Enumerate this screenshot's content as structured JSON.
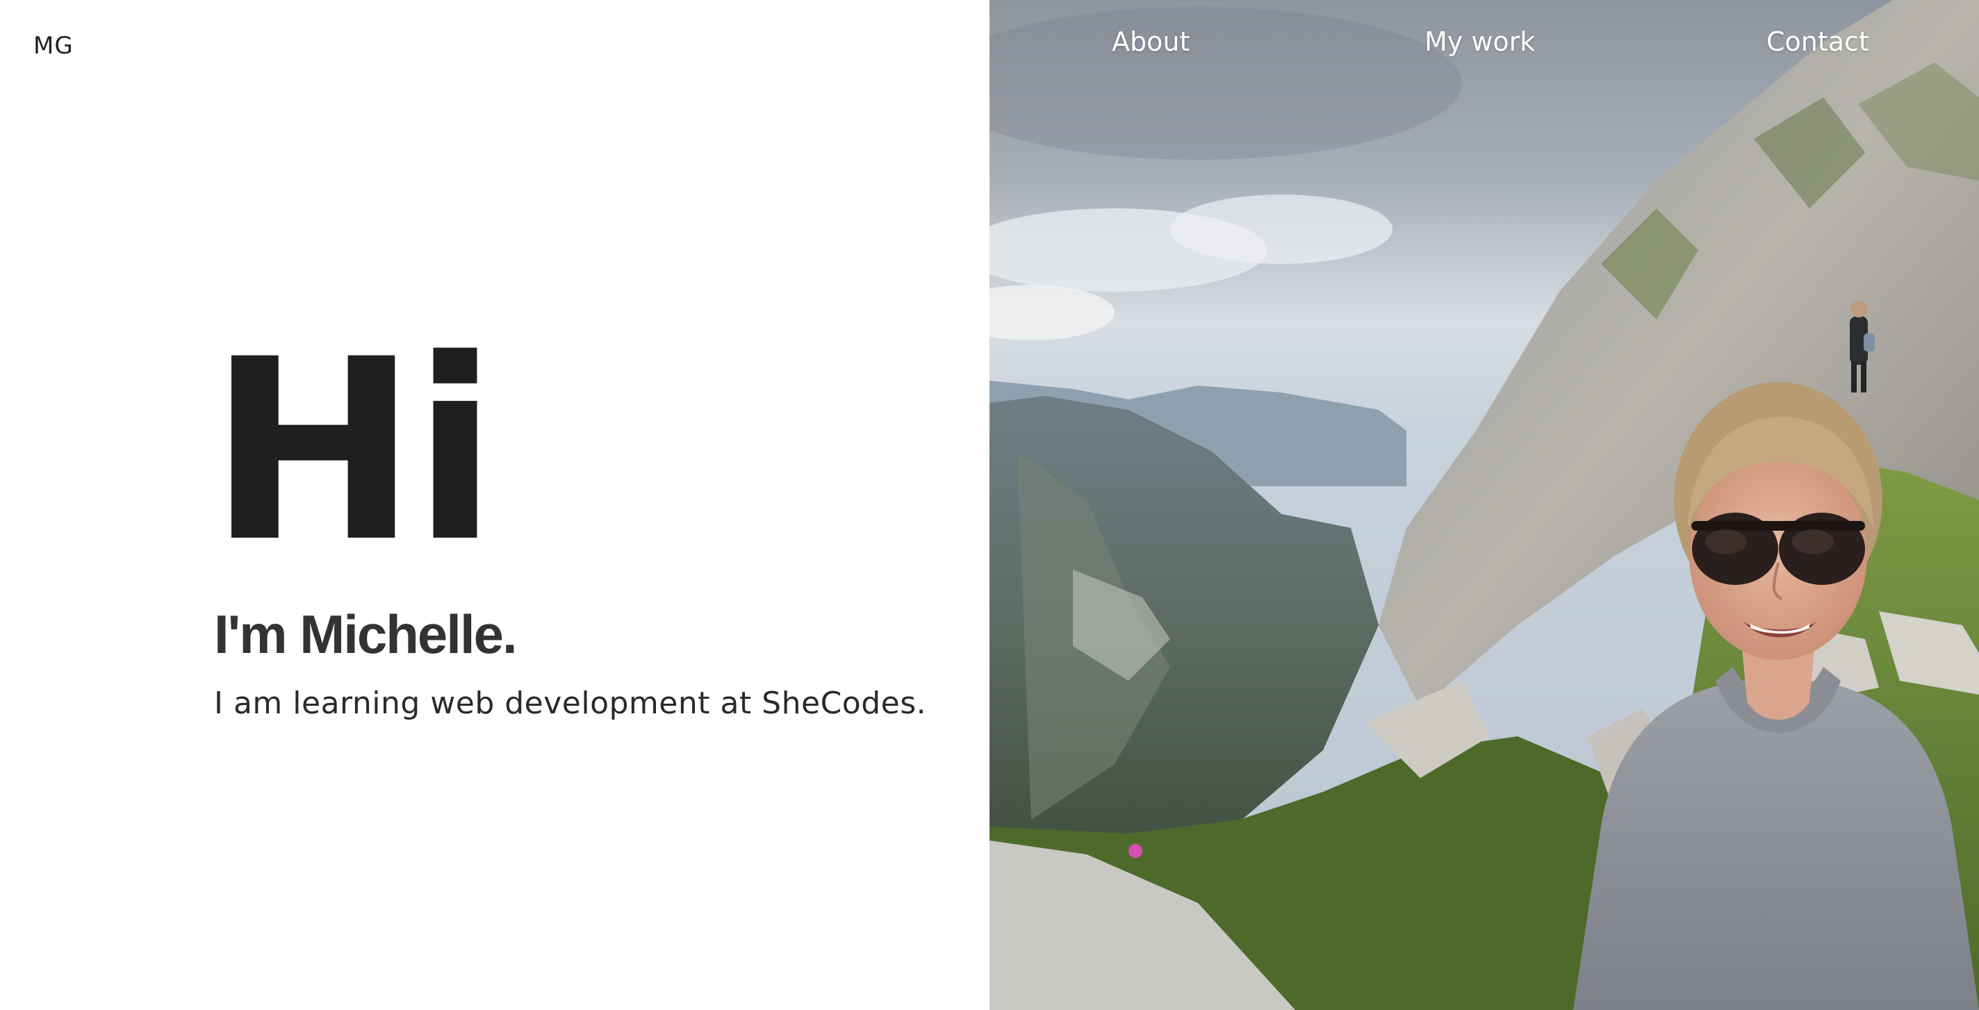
{
  "header": {
    "logo": "MG"
  },
  "nav": {
    "items": [
      {
        "label": "About"
      },
      {
        "label": "My work"
      },
      {
        "label": "Contact"
      }
    ]
  },
  "hero": {
    "greeting": "Hi",
    "name": "I'm Michelle.",
    "tagline": "I am learning web development at SheCodes."
  },
  "colors": {
    "heading": "#1f1f1f",
    "text": "#333333",
    "nav_text": "#ffffff",
    "background": "#ffffff"
  },
  "photo": {
    "description_icon": "photo-image"
  }
}
